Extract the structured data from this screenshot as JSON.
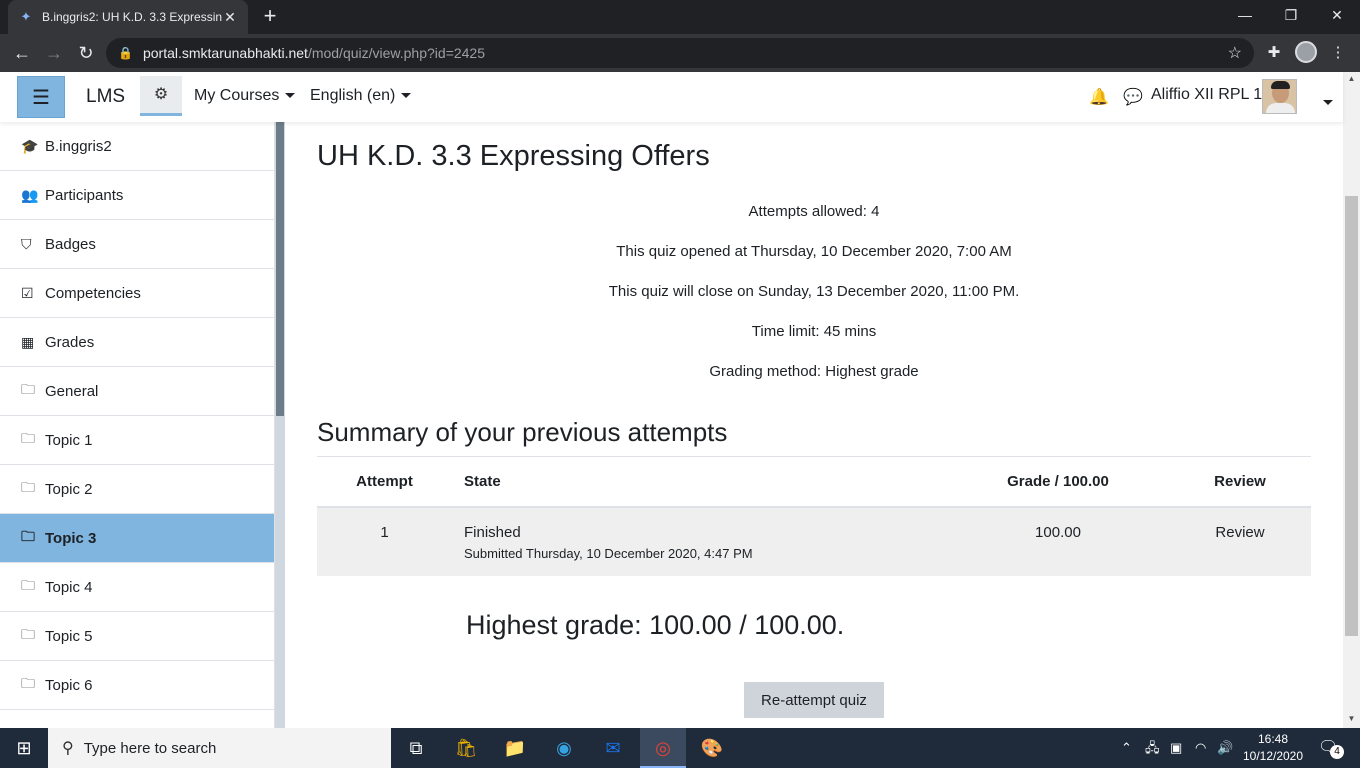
{
  "browser": {
    "tab_title": "B.inggris2: UH K.D. 3.3 Expressing",
    "url_host": "portal.smktarunabhakti.net",
    "url_path": "/mod/quiz/view.php?id=2425"
  },
  "navbar": {
    "brand": "LMS",
    "my_courses": "My Courses",
    "language": "English (en)",
    "user_name": "Aliffio XII RPL 1"
  },
  "sidebar": {
    "items": [
      {
        "label": "B.inggris2",
        "icon": "graduation-cap-icon",
        "glyph": "🎓",
        "active": false
      },
      {
        "label": "Participants",
        "icon": "users-icon",
        "glyph": "👥",
        "active": false
      },
      {
        "label": "Badges",
        "icon": "shield-icon",
        "glyph": "⛉",
        "active": false
      },
      {
        "label": "Competencies",
        "icon": "checkbox-icon",
        "glyph": "☑",
        "active": false
      },
      {
        "label": "Grades",
        "icon": "table-icon",
        "glyph": "▦",
        "active": false
      },
      {
        "label": "General",
        "icon": "folder-icon",
        "glyph": "🗀",
        "active": false
      },
      {
        "label": "Topic 1",
        "icon": "folder-icon",
        "glyph": "🗀",
        "active": false
      },
      {
        "label": "Topic 2",
        "icon": "folder-icon",
        "glyph": "🗀",
        "active": false
      },
      {
        "label": "Topic 3",
        "icon": "folder-icon",
        "glyph": "🗀",
        "active": true
      },
      {
        "label": "Topic 4",
        "icon": "folder-icon",
        "glyph": "🗀",
        "active": false
      },
      {
        "label": "Topic 5",
        "icon": "folder-icon",
        "glyph": "🗀",
        "active": false
      },
      {
        "label": "Topic 6",
        "icon": "folder-icon",
        "glyph": "🗀",
        "active": false
      }
    ]
  },
  "quiz": {
    "title": "UH K.D. 3.3 Expressing Offers",
    "attempts_allowed": "Attempts allowed: 4",
    "opened": "This quiz opened at Thursday, 10 December 2020, 7:00 AM",
    "closes": "This quiz will close on Sunday, 13 December 2020, 11:00 PM.",
    "time_limit": "Time limit: 45 mins",
    "grading_method": "Grading method: Highest grade",
    "summary_heading": "Summary of your previous attempts",
    "table": {
      "headers": [
        "Attempt",
        "State",
        "Grade / 100.00",
        "Review"
      ],
      "rows": [
        {
          "attempt": "1",
          "state": "Finished",
          "submitted": "Submitted Thursday, 10 December 2020, 4:47 PM",
          "grade": "100.00",
          "review": "Review"
        }
      ]
    },
    "highest_grade": "Highest grade: 100.00 / 100.00.",
    "reattempt_label": "Re-attempt quiz"
  },
  "taskbar": {
    "search_placeholder": "Type here to search",
    "time": "16:48",
    "date": "10/12/2020",
    "notifications": "4"
  }
}
